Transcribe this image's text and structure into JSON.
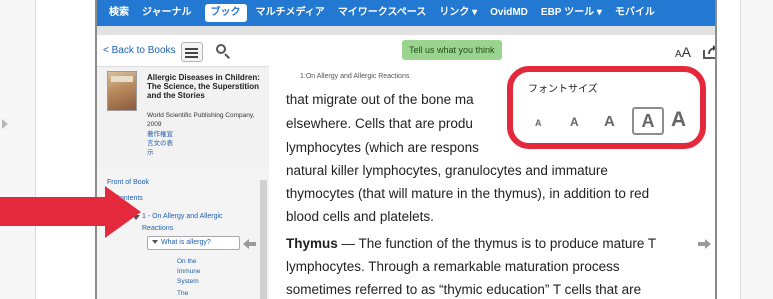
{
  "navbar": {
    "items": [
      "検索",
      "ジャーナル",
      "ブック",
      "マルチメディア",
      "マイワークスペース",
      "リンク",
      "OvidMD",
      "EBP ツール",
      "モバイル"
    ],
    "active_index": 2,
    "dropdown_glyph": "▾",
    "background_color": "#2379d1"
  },
  "toolbar": {
    "back_label": "< Back to Books",
    "feedback_label": "Tell us what you think",
    "font_small_glyph": "A",
    "font_large_glyph": "A",
    "icons": [
      "list-icon",
      "search-icon",
      "font-size-icon",
      "share-icon"
    ]
  },
  "book": {
    "title": "Allergic Diseases in Children: The Science, the Superstition and the Stories",
    "publisher": "World Scientific Publishing Company, 2009",
    "links": [
      "著作権宣",
      "言文の表",
      "示"
    ]
  },
  "toc": {
    "front_of_book": "Front of Book",
    "table_of_contents": "of Contents",
    "chapter": "1 - On Allergy and Allergic",
    "chapter_cont": "Reactions",
    "current_section": "What is allergy?",
    "sub_items": [
      "On the",
      "Immune",
      "System",
      "The"
    ]
  },
  "reader": {
    "chapter_crumb": "1:On Allergy and Allergic Reactions",
    "lines": [
      "that migrate out of the bone ma",
      "elsewhere. Cells that are produ",
      "lymphocytes (which are respons",
      "natural killer lymphocytes, granulocytes and immature",
      "thymocytes (that will mature in the thymus), in addition to red",
      "blood cells and platelets."
    ],
    "thymus_term": "Thymus",
    "thymus_rest": " — The function of the thymus is to produce mature T",
    "line8": "lymphocytes. Through a remarkable maturation process",
    "line9": "sometimes referred to as “thymic education” T cells that are"
  },
  "font_popup": {
    "title": "フォントサイズ",
    "options": [
      "A",
      "A",
      "A",
      "A",
      "A"
    ],
    "selected_index": 3,
    "border_color": "#e5293d"
  },
  "annotation": {
    "arrow_color": "#e5293d"
  }
}
